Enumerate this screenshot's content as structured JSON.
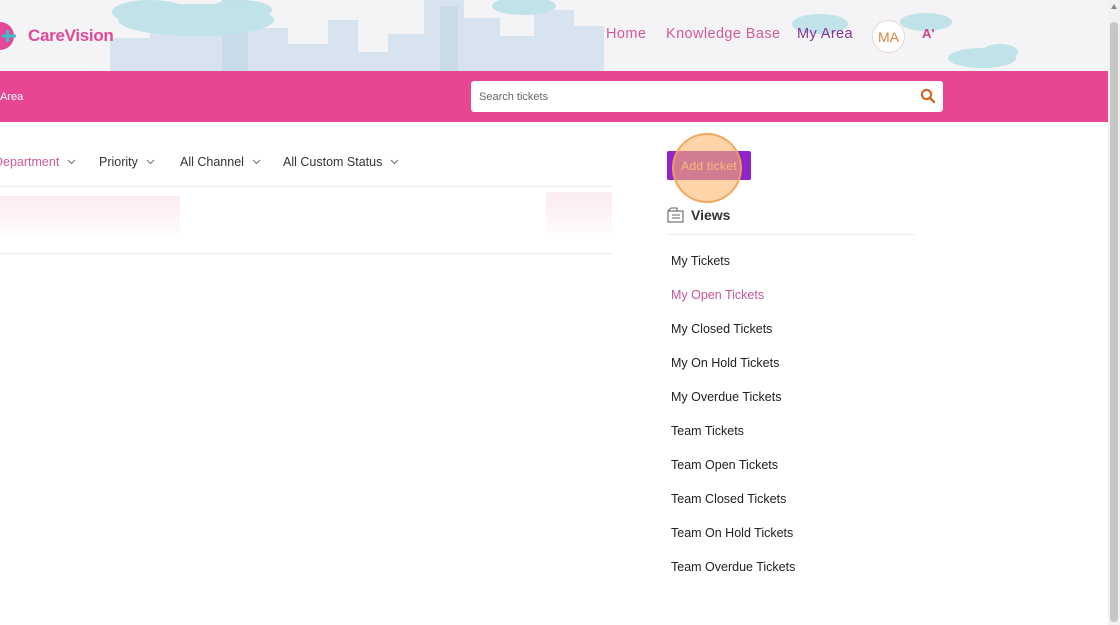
{
  "header": {
    "brand_name": "CareVision",
    "nav": [
      {
        "label": "Home",
        "active": false
      },
      {
        "label": "Knowledge Base",
        "active": false
      },
      {
        "label": "My Area",
        "active": true
      }
    ],
    "avatar_initials": "MA",
    "font_toggle_label": "A'"
  },
  "toolbar": {
    "breadcrumb": "Area",
    "search": {
      "placeholder": "Search tickets",
      "value": ""
    }
  },
  "filters": [
    {
      "label": "Department"
    },
    {
      "label": "Priority"
    },
    {
      "label": "All Channel"
    },
    {
      "label": "All Custom Status"
    }
  ],
  "sidebar": {
    "add_ticket_label": "Add ticket",
    "views_title": "Views",
    "views": [
      {
        "label": "My Tickets",
        "active": false
      },
      {
        "label": "My Open Tickets",
        "active": true
      },
      {
        "label": "My Closed Tickets",
        "active": false
      },
      {
        "label": "My On Hold Tickets",
        "active": false
      },
      {
        "label": "My Overdue Tickets",
        "active": false
      },
      {
        "label": "Team Tickets",
        "active": false
      },
      {
        "label": "Team Open Tickets",
        "active": false
      },
      {
        "label": "Team Closed Tickets",
        "active": false
      },
      {
        "label": "Team On Hold Tickets",
        "active": false
      },
      {
        "label": "Team Overdue Tickets",
        "active": false
      }
    ]
  },
  "colors": {
    "brand_pink": "#e84593",
    "brand_purple": "#8e24c9",
    "accent_text": "#d05a9a",
    "active_nav": "#8a2f9c"
  }
}
